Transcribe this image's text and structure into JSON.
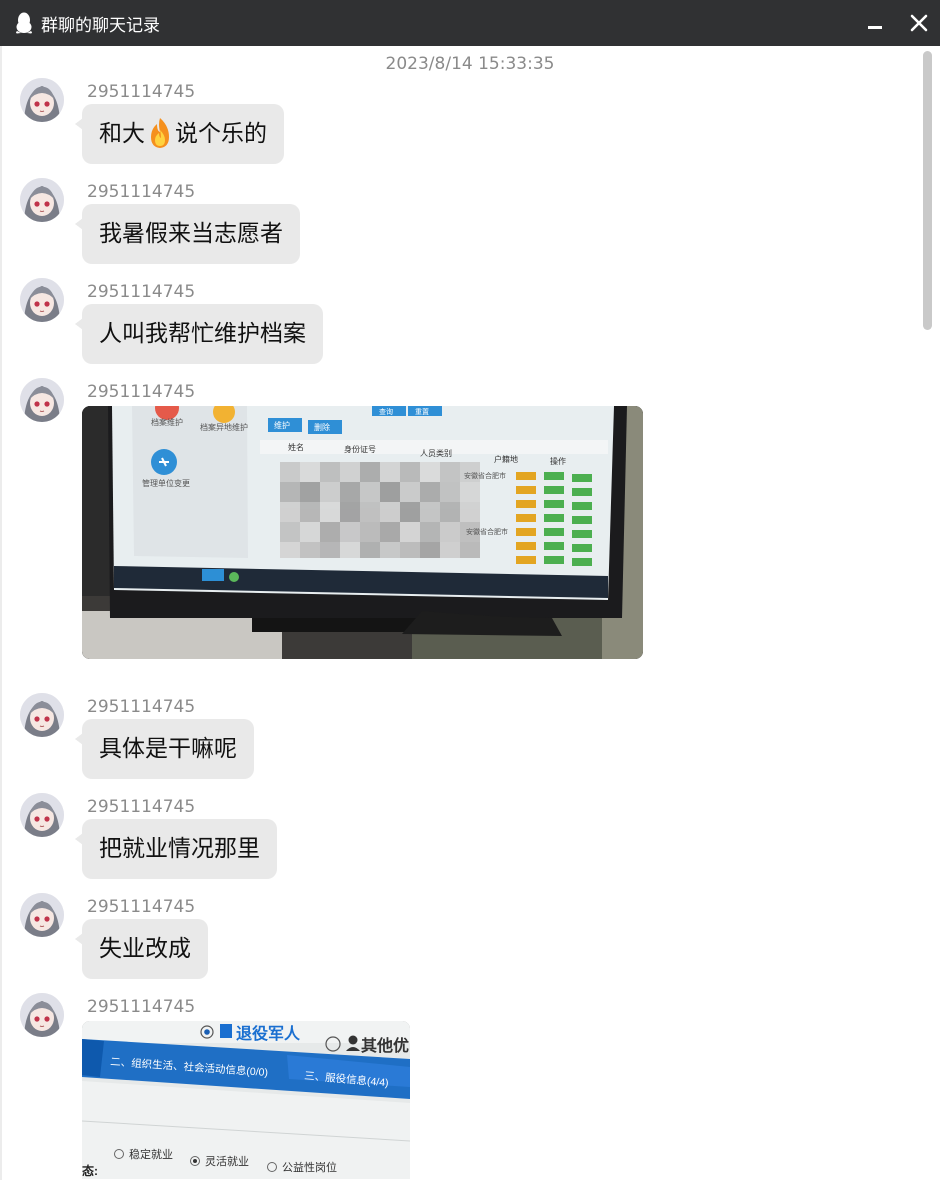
{
  "window": {
    "title": "群聊的聊天记录",
    "minimize_icon": "minimize-icon",
    "close_icon": "close-icon",
    "app_icon": "qq-penguin-icon"
  },
  "timestamp": "2023/8/14 15:33:35",
  "messages": [
    {
      "sender": "2951114745",
      "type": "text",
      "text_before": "和大",
      "emoji": "fire-emoji",
      "text_after": "说个乐的"
    },
    {
      "sender": "2951114745",
      "type": "text",
      "text": "我暑假来当志愿者"
    },
    {
      "sender": "2951114745",
      "type": "text",
      "text": "人叫我帮忙维护档案"
    },
    {
      "sender": "2951114745",
      "type": "image",
      "image": {
        "sidebar_items": [
          "档案维护",
          "档案异地维护",
          "管理单位变更"
        ],
        "toolbar_buttons": [
          "维护",
          "删除"
        ],
        "top_buttons": [
          "查询",
          "重置"
        ],
        "columns": [
          "姓名",
          "身份证号",
          "人员类别",
          "户籍地",
          "操作"
        ],
        "row_text": "安徽省合肥市"
      }
    },
    {
      "sender": "2951114745",
      "type": "text",
      "text": "具体是干嘛呢"
    },
    {
      "sender": "2951114745",
      "type": "text",
      "text": "把就业情况那里"
    },
    {
      "sender": "2951114745",
      "type": "text",
      "text": "失业改成"
    },
    {
      "sender": "2951114745",
      "type": "image",
      "image": {
        "radio_veteran": "退役军人",
        "radio_other": "其他优",
        "tab_org": "二、组织生活、社会活动信息(0/0)",
        "tab_service": "三、服役信息(4/4)",
        "options": [
          "稳定就业",
          "灵活就业",
          "公益性岗位"
        ],
        "label_fragment": "态:"
      }
    }
  ]
}
